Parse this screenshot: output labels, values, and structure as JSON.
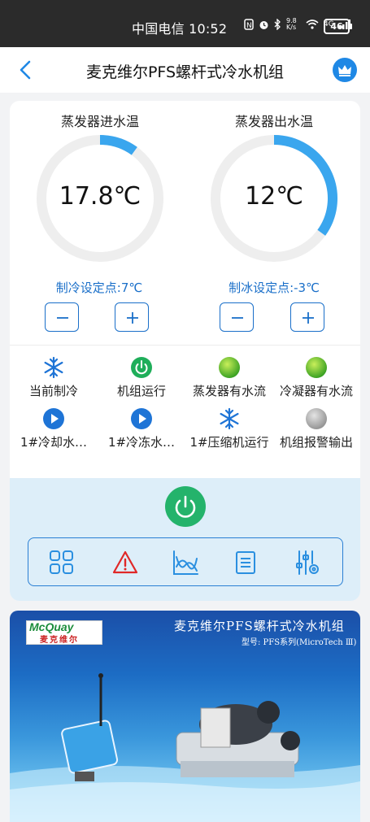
{
  "status_bar": {
    "carrier_time": "中国电信 10:52",
    "net_speed": "9.8 K/s",
    "signal": "4G",
    "battery": "46"
  },
  "header": {
    "title": "麦克维尔PFS螺杆式冷水机组",
    "back_icon": "chevron-left-icon",
    "crown_icon": "crown-icon"
  },
  "gauges": [
    {
      "label": "蒸发器进水温",
      "value": "17.8℃",
      "arc_fraction": 0.1,
      "setpoint": "制冷设定点:7℃"
    },
    {
      "label": "蒸发器出水温",
      "value": "12℃",
      "arc_fraction": 0.35,
      "setpoint": "制冰设定点:-3℃"
    }
  ],
  "stepper": {
    "minus_icon": "minus-icon",
    "plus_icon": "plus-icon"
  },
  "status_items": [
    {
      "label": "当前制冷",
      "icon": "snowflake-icon"
    },
    {
      "label": "机组运行",
      "icon": "power-on-icon"
    },
    {
      "label": "蒸发器有水流",
      "icon": "green-dot-icon"
    },
    {
      "label": "冷凝器有水流",
      "icon": "green-dot-icon"
    },
    {
      "label": "1#冷却水…",
      "icon": "play-icon"
    },
    {
      "label": "1#冷冻水…",
      "icon": "play-icon"
    },
    {
      "label": "1#压缩机运行",
      "icon": "snowflake-icon"
    },
    {
      "label": "机组报警输出",
      "icon": "gray-dot-icon"
    }
  ],
  "toolbar": [
    {
      "name": "grid-icon"
    },
    {
      "name": "alarm-icon"
    },
    {
      "name": "trend-chart-icon"
    },
    {
      "name": "list-icon"
    },
    {
      "name": "settings-sliders-icon"
    }
  ],
  "banner": {
    "title": "麦克维尔PFS螺杆式冷水机组",
    "subtitle": "型号: PFS系列(MicroTech Ⅲ)",
    "logo_text": "McQuay",
    "logo_cn": "麦克维尔"
  },
  "colors": {
    "accent": "#1a6fc9",
    "gauge_arc": "#3aa6ee",
    "power_green": "#24b36b",
    "panel_bg": "#ddeef9"
  }
}
